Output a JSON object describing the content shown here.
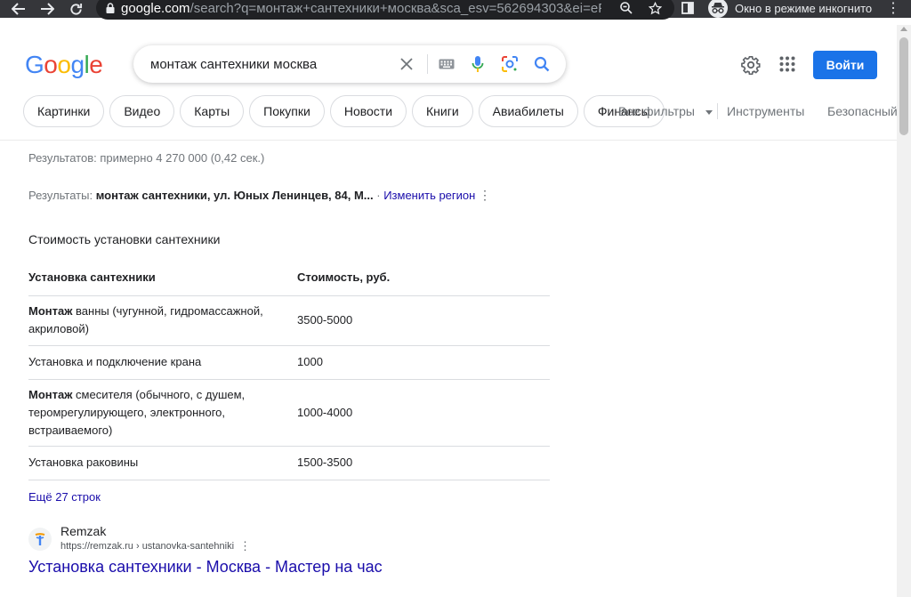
{
  "browser": {
    "url_host": "google.com",
    "url_rest": "/search?q=монтаж+сантехники+москва&sca_esv=562694303&ei=ePX2...",
    "incognito_label": "Окно в режиме инкогнито",
    "icons": [
      "back-icon",
      "forward-icon",
      "reload-icon",
      "lock-icon",
      "zoom-icon",
      "star-icon",
      "side-panel-icon",
      "incognito-icon",
      "menu-icon"
    ]
  },
  "header": {
    "logo_letters": [
      "G",
      "o",
      "o",
      "g",
      "l",
      "e"
    ],
    "logo_colors": [
      "#4285f4",
      "#ea4335",
      "#fbbc05",
      "#4285f4",
      "#34a853",
      "#ea4335"
    ],
    "search_value": "монтаж сантехники москва",
    "signin_label": "Войти"
  },
  "chips": [
    "Картинки",
    "Видео",
    "Карты",
    "Покупки",
    "Новости",
    "Книги",
    "Авиабилеты",
    "Финансы"
  ],
  "tools": {
    "all_filters": "Все фильтры",
    "instruments": "Инструменты",
    "safe_search": "Безопасный п"
  },
  "results": {
    "stats": "Результатов: примерно 4 270 000 (0,42 сек.)",
    "region_prefix": "Результаты: ",
    "region_value": "монтаж сантехники, ул. Юных Ленинцев, 84, М...",
    "region_sep": " · ",
    "region_change": "Изменить регион"
  },
  "snippet": {
    "title": "Стоимость установки сантехники",
    "headers": [
      "Установка сантехники",
      "Стоимость, руб."
    ],
    "rows": [
      {
        "bold": "Монтаж",
        "text": " ванны (чугунной, гидромассажной, акриловой)",
        "price": "3500-5000"
      },
      {
        "bold": "",
        "text": "Установка и подключение крана",
        "price": "1000"
      },
      {
        "bold": "Монтаж",
        "text": " смесителя (обычного, с душем, теромрегулирующего, электронного, встраиваемого)",
        "price": "1000-4000"
      },
      {
        "bold": "",
        "text": "Установка раковины",
        "price": "1500-3500"
      }
    ],
    "more": "Ещё 27 строк"
  },
  "first_result": {
    "site_name": "Remzak",
    "url": "https://remzak.ru › ustanovka-santehniki",
    "title": "Установка сантехники - Москва - Мастер на час"
  },
  "colors": {
    "link": "#1a0dab",
    "accent_blue": "#1a73e8",
    "chrome_dark": "#35363a"
  }
}
